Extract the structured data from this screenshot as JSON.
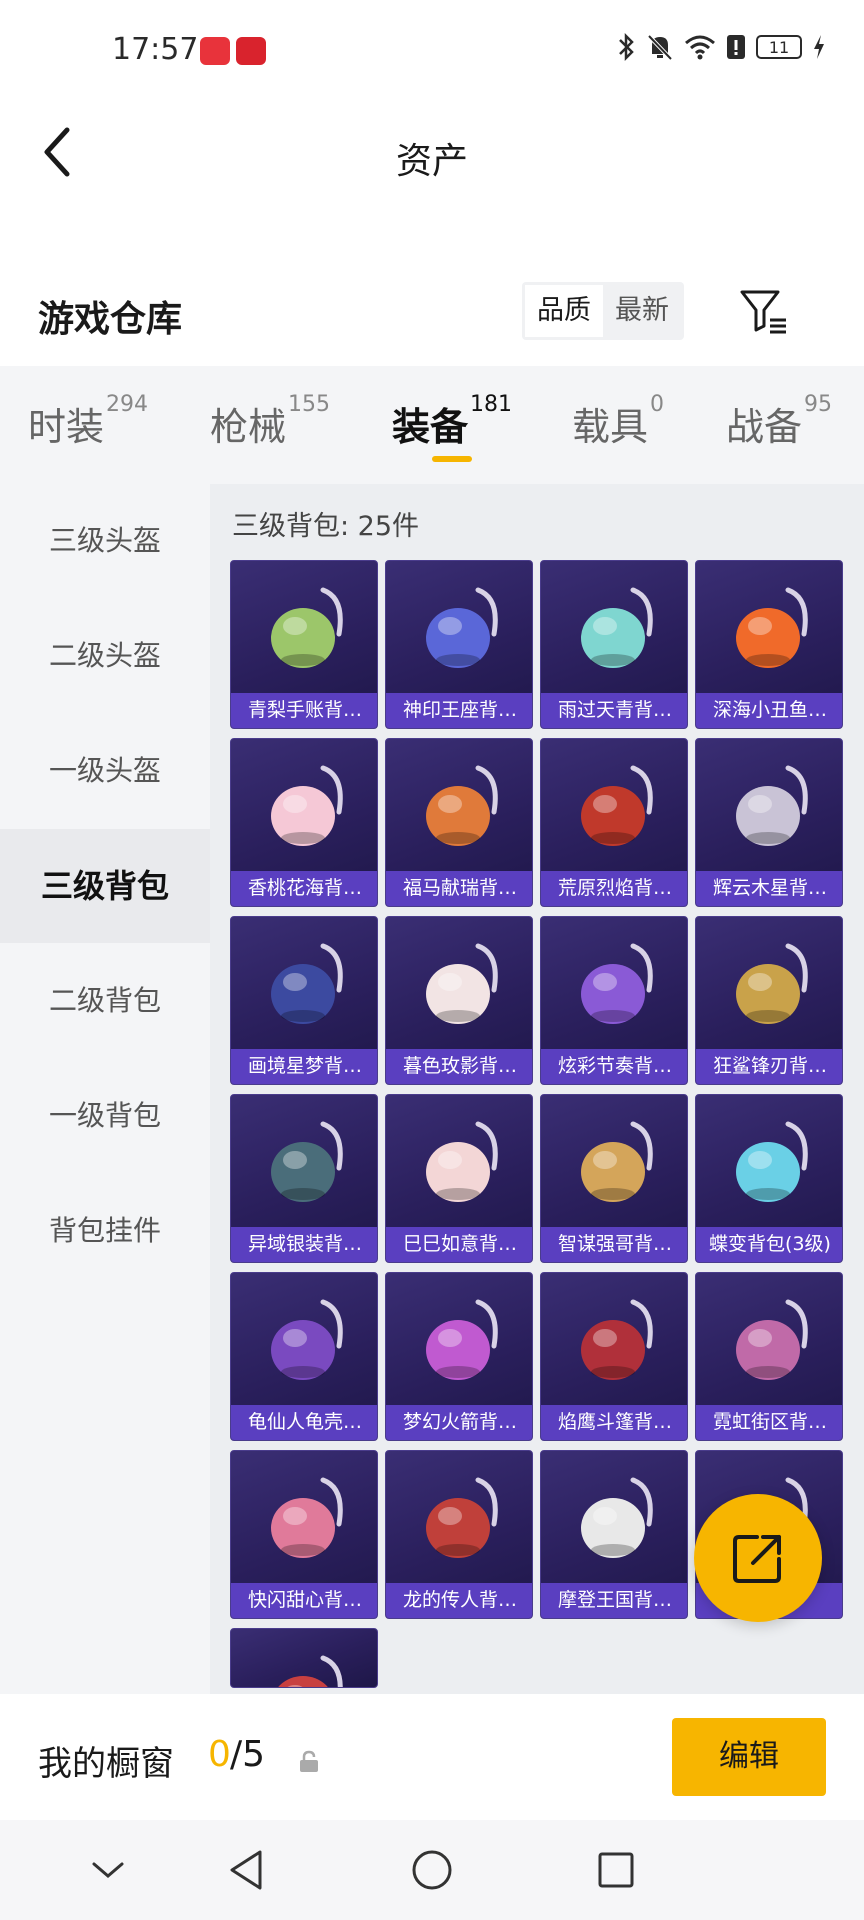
{
  "status_bar": {
    "time": "17:57",
    "battery": "11",
    "app_colors": [
      "#e8333b",
      "#d9232d"
    ],
    "icons": [
      "bluetooth-icon",
      "mute-icon",
      "wifi-icon",
      "alert-icon",
      "battery-icon",
      "charging-icon"
    ]
  },
  "header": {
    "title": "资产",
    "back_icon": "chevron-left-icon"
  },
  "warehouse": {
    "title": "游戏仓库",
    "sort_options": [
      "品质",
      "最新"
    ],
    "sort_selected": "品质",
    "filter_icon": "filter-icon"
  },
  "tabs": [
    {
      "label": "时装",
      "count": "294",
      "active": false
    },
    {
      "label": "枪械",
      "count": "155",
      "active": false
    },
    {
      "label": "装备",
      "count": "181",
      "active": true
    },
    {
      "label": "载具",
      "count": "0",
      "active": false
    },
    {
      "label": "战备",
      "count": "95",
      "active": false
    }
  ],
  "sidebar": {
    "items": [
      "三级头盔",
      "二级头盔",
      "一级头盔",
      "三级背包",
      "二级背包",
      "一级背包",
      "背包挂件"
    ],
    "selected": "三级背包"
  },
  "content": {
    "count_label": "三级背包: 25件",
    "items": [
      {
        "name": "青梨手账背…",
        "icon": "pear-backpack-icon",
        "color": "#9cc66a"
      },
      {
        "name": "神印王座背…",
        "icon": "throne-backpack-icon",
        "color": "#5a67d8"
      },
      {
        "name": "雨过天青背…",
        "icon": "clover-backpack-icon",
        "color": "#7fd6d0"
      },
      {
        "name": "深海小丑鱼…",
        "icon": "clownfish-backpack-icon",
        "color": "#f06a2a"
      },
      {
        "name": "香桃花海背…",
        "icon": "peach-dress-backpack-icon",
        "color": "#f5c8d6"
      },
      {
        "name": "福马献瑞背…",
        "icon": "horse-backpack-icon",
        "color": "#e07a3a"
      },
      {
        "name": "荒原烈焰背…",
        "icon": "flame-backpack-icon",
        "color": "#c0392b"
      },
      {
        "name": "辉云木星背…",
        "icon": "jupiter-backpack-icon",
        "color": "#c9c3d6"
      },
      {
        "name": "画境星梦背…",
        "icon": "mirror-backpack-icon",
        "color": "#3c4aa0"
      },
      {
        "name": "暮色玫影背…",
        "icon": "doll-backpack-icon",
        "color": "#f2e4e4"
      },
      {
        "name": "炫彩节奏背…",
        "icon": "colorful-backpack-icon",
        "color": "#8a5ad6"
      },
      {
        "name": "狂鲨锋刃背…",
        "icon": "shark-backpack-icon",
        "color": "#c9a24a"
      },
      {
        "name": "异域银装背…",
        "icon": "silver-backpack-icon",
        "color": "#4a6d7a"
      },
      {
        "name": "巳巳如意背…",
        "icon": "snake-backpack-icon",
        "color": "#f3d6d6"
      },
      {
        "name": "智谋强哥背…",
        "icon": "bear-backpack-icon",
        "color": "#d4a55a"
      },
      {
        "name": "蝶变背包(3级)",
        "icon": "butterfly-backpack-icon",
        "color": "#6ad0e6"
      },
      {
        "name": "龟仙人龟壳…",
        "icon": "turtle-shell-icon",
        "color": "#7a4ac0"
      },
      {
        "name": "梦幻火箭背…",
        "icon": "rocket-backpack-icon",
        "color": "#c05ad0"
      },
      {
        "name": "焰鹰斗篷背…",
        "icon": "eagle-backpack-icon",
        "color": "#b0303a"
      },
      {
        "name": "霓虹街区背…",
        "icon": "neon-backpack-icon",
        "color": "#c06aa8"
      },
      {
        "name": "快闪甜心背…",
        "icon": "heart-backpack-icon",
        "color": "#e07a9a"
      },
      {
        "name": "龙的传人背…",
        "icon": "dragon-backpack-icon",
        "color": "#c0403a"
      },
      {
        "name": "摩登王国背…",
        "icon": "panda-backpack-icon",
        "color": "#e8e8e8"
      },
      {
        "name": "",
        "icon": "red-backpack-icon",
        "color": "#a83030"
      },
      {
        "name": "",
        "icon": "red-white-backpack-icon",
        "color": "#c84040"
      }
    ]
  },
  "share_icon": "share-icon",
  "showcase": {
    "label": "我的橱窗",
    "used": "0",
    "total": "/5",
    "lock_icon": "lock-icon",
    "edit_label": "编辑"
  },
  "system_nav": [
    "chevron-down-icon",
    "back-triangle-icon",
    "home-circle-icon",
    "recents-square-icon"
  ]
}
